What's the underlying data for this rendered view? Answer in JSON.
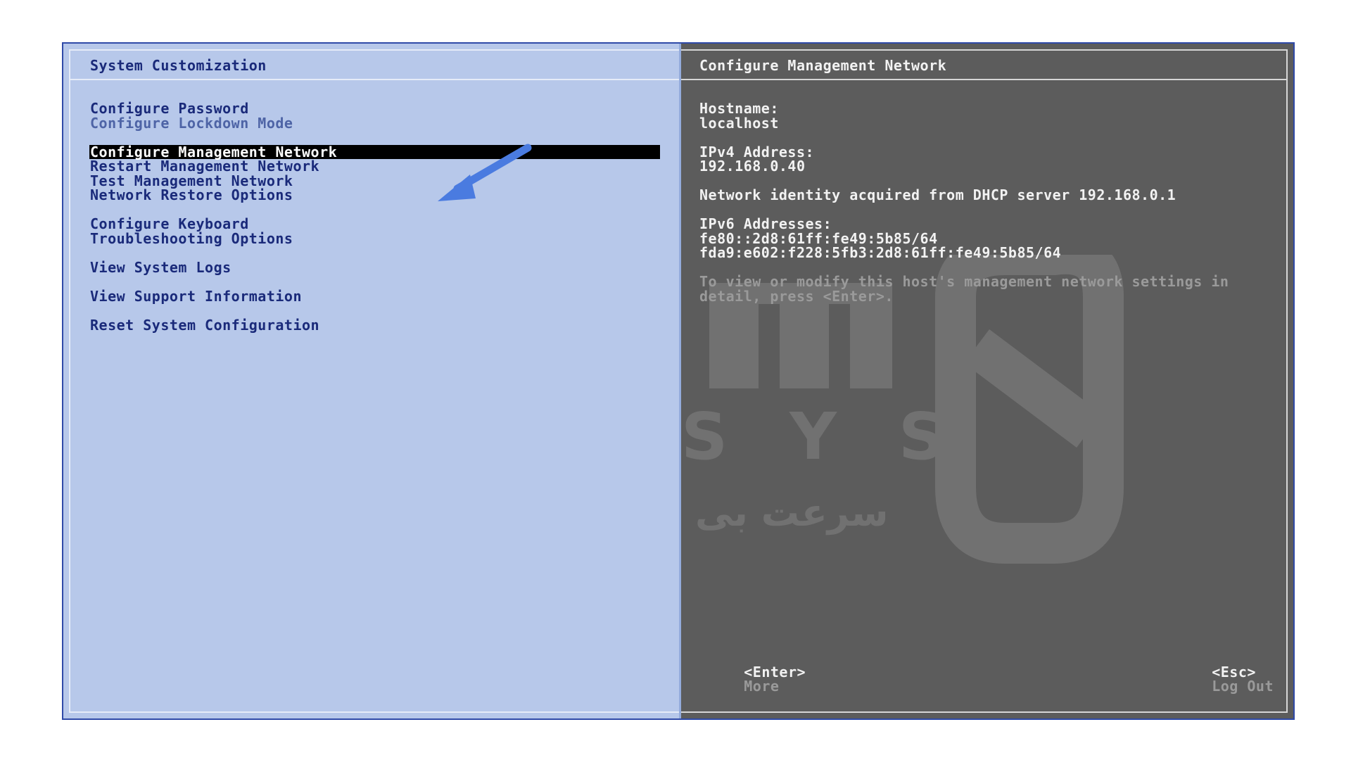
{
  "left_panel": {
    "title": "System Customization",
    "menu": [
      {
        "label": "Configure Password",
        "enabled": true
      },
      {
        "label": "Configure Lockdown Mode",
        "enabled": false
      },
      {
        "label": "Configure Management Network",
        "enabled": true,
        "selected": true
      },
      {
        "label": "Restart Management Network",
        "enabled": true
      },
      {
        "label": "Test Management Network",
        "enabled": true
      },
      {
        "label": "Network Restore Options",
        "enabled": true
      },
      {
        "label": "Configure Keyboard",
        "enabled": true
      },
      {
        "label": "Troubleshooting Options",
        "enabled": true
      },
      {
        "label": "View System Logs",
        "enabled": true
      },
      {
        "label": "View Support Information",
        "enabled": true
      },
      {
        "label": "Reset System Configuration",
        "enabled": true
      }
    ]
  },
  "right_panel": {
    "title": "Configure Management Network",
    "hostname_label": "Hostname:",
    "hostname_value": "localhost",
    "ipv4_label": "IPv4 Address:",
    "ipv4_value": "192.168.0.40",
    "dhcp_note": "Network identity acquired from DHCP server 192.168.0.1",
    "ipv6_label": "IPv6 Addresses:",
    "ipv6_values": [
      "fe80::2d8:61ff:fe49:5b85/64",
      "fda9:e602:f228:5fb3:2d8:61ff:fe49:5b85/64"
    ],
    "help_text": "To view or modify this host's management network settings in detail, press <Enter>."
  },
  "footer": {
    "enter_key": "<Enter>",
    "enter_action": "More",
    "esc_key": "<Esc>",
    "esc_action": "Log Out"
  },
  "watermark": {
    "line1": "SYS",
    "line2": "سرعت بی"
  },
  "colors": {
    "left_background": "#b7c8ea",
    "right_background": "#5c5c5c",
    "menu_text": "#1a2a7a",
    "disabled_text": "#4e64a6",
    "selection_background": "#000000",
    "arrow": "#4a7be0"
  }
}
